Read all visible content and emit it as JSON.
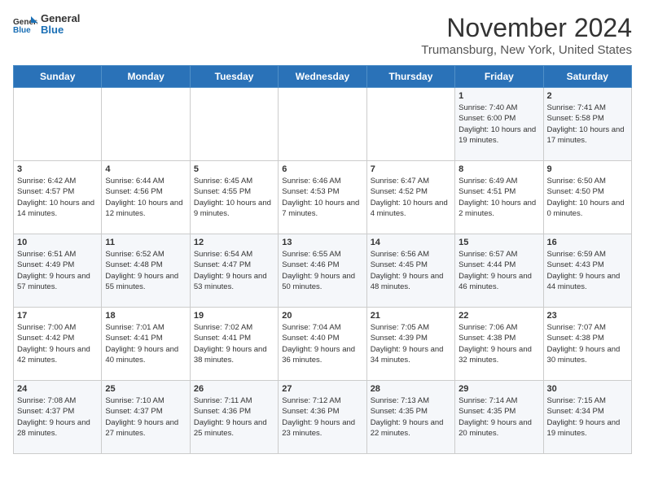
{
  "header": {
    "logo_general": "General",
    "logo_blue": "Blue",
    "title": "November 2024",
    "location": "Trumansburg, New York, United States"
  },
  "weekdays": [
    "Sunday",
    "Monday",
    "Tuesday",
    "Wednesday",
    "Thursday",
    "Friday",
    "Saturday"
  ],
  "weeks": [
    [
      {
        "day": "",
        "info": ""
      },
      {
        "day": "",
        "info": ""
      },
      {
        "day": "",
        "info": ""
      },
      {
        "day": "",
        "info": ""
      },
      {
        "day": "",
        "info": ""
      },
      {
        "day": "1",
        "info": "Sunrise: 7:40 AM\nSunset: 6:00 PM\nDaylight: 10 hours and 19 minutes."
      },
      {
        "day": "2",
        "info": "Sunrise: 7:41 AM\nSunset: 5:58 PM\nDaylight: 10 hours and 17 minutes."
      }
    ],
    [
      {
        "day": "3",
        "info": "Sunrise: 6:42 AM\nSunset: 4:57 PM\nDaylight: 10 hours and 14 minutes."
      },
      {
        "day": "4",
        "info": "Sunrise: 6:44 AM\nSunset: 4:56 PM\nDaylight: 10 hours and 12 minutes."
      },
      {
        "day": "5",
        "info": "Sunrise: 6:45 AM\nSunset: 4:55 PM\nDaylight: 10 hours and 9 minutes."
      },
      {
        "day": "6",
        "info": "Sunrise: 6:46 AM\nSunset: 4:53 PM\nDaylight: 10 hours and 7 minutes."
      },
      {
        "day": "7",
        "info": "Sunrise: 6:47 AM\nSunset: 4:52 PM\nDaylight: 10 hours and 4 minutes."
      },
      {
        "day": "8",
        "info": "Sunrise: 6:49 AM\nSunset: 4:51 PM\nDaylight: 10 hours and 2 minutes."
      },
      {
        "day": "9",
        "info": "Sunrise: 6:50 AM\nSunset: 4:50 PM\nDaylight: 10 hours and 0 minutes."
      }
    ],
    [
      {
        "day": "10",
        "info": "Sunrise: 6:51 AM\nSunset: 4:49 PM\nDaylight: 9 hours and 57 minutes."
      },
      {
        "day": "11",
        "info": "Sunrise: 6:52 AM\nSunset: 4:48 PM\nDaylight: 9 hours and 55 minutes."
      },
      {
        "day": "12",
        "info": "Sunrise: 6:54 AM\nSunset: 4:47 PM\nDaylight: 9 hours and 53 minutes."
      },
      {
        "day": "13",
        "info": "Sunrise: 6:55 AM\nSunset: 4:46 PM\nDaylight: 9 hours and 50 minutes."
      },
      {
        "day": "14",
        "info": "Sunrise: 6:56 AM\nSunset: 4:45 PM\nDaylight: 9 hours and 48 minutes."
      },
      {
        "day": "15",
        "info": "Sunrise: 6:57 AM\nSunset: 4:44 PM\nDaylight: 9 hours and 46 minutes."
      },
      {
        "day": "16",
        "info": "Sunrise: 6:59 AM\nSunset: 4:43 PM\nDaylight: 9 hours and 44 minutes."
      }
    ],
    [
      {
        "day": "17",
        "info": "Sunrise: 7:00 AM\nSunset: 4:42 PM\nDaylight: 9 hours and 42 minutes."
      },
      {
        "day": "18",
        "info": "Sunrise: 7:01 AM\nSunset: 4:41 PM\nDaylight: 9 hours and 40 minutes."
      },
      {
        "day": "19",
        "info": "Sunrise: 7:02 AM\nSunset: 4:41 PM\nDaylight: 9 hours and 38 minutes."
      },
      {
        "day": "20",
        "info": "Sunrise: 7:04 AM\nSunset: 4:40 PM\nDaylight: 9 hours and 36 minutes."
      },
      {
        "day": "21",
        "info": "Sunrise: 7:05 AM\nSunset: 4:39 PM\nDaylight: 9 hours and 34 minutes."
      },
      {
        "day": "22",
        "info": "Sunrise: 7:06 AM\nSunset: 4:38 PM\nDaylight: 9 hours and 32 minutes."
      },
      {
        "day": "23",
        "info": "Sunrise: 7:07 AM\nSunset: 4:38 PM\nDaylight: 9 hours and 30 minutes."
      }
    ],
    [
      {
        "day": "24",
        "info": "Sunrise: 7:08 AM\nSunset: 4:37 PM\nDaylight: 9 hours and 28 minutes."
      },
      {
        "day": "25",
        "info": "Sunrise: 7:10 AM\nSunset: 4:37 PM\nDaylight: 9 hours and 27 minutes."
      },
      {
        "day": "26",
        "info": "Sunrise: 7:11 AM\nSunset: 4:36 PM\nDaylight: 9 hours and 25 minutes."
      },
      {
        "day": "27",
        "info": "Sunrise: 7:12 AM\nSunset: 4:36 PM\nDaylight: 9 hours and 23 minutes."
      },
      {
        "day": "28",
        "info": "Sunrise: 7:13 AM\nSunset: 4:35 PM\nDaylight: 9 hours and 22 minutes."
      },
      {
        "day": "29",
        "info": "Sunrise: 7:14 AM\nSunset: 4:35 PM\nDaylight: 9 hours and 20 minutes."
      },
      {
        "day": "30",
        "info": "Sunrise: 7:15 AM\nSunset: 4:34 PM\nDaylight: 9 hours and 19 minutes."
      }
    ]
  ]
}
